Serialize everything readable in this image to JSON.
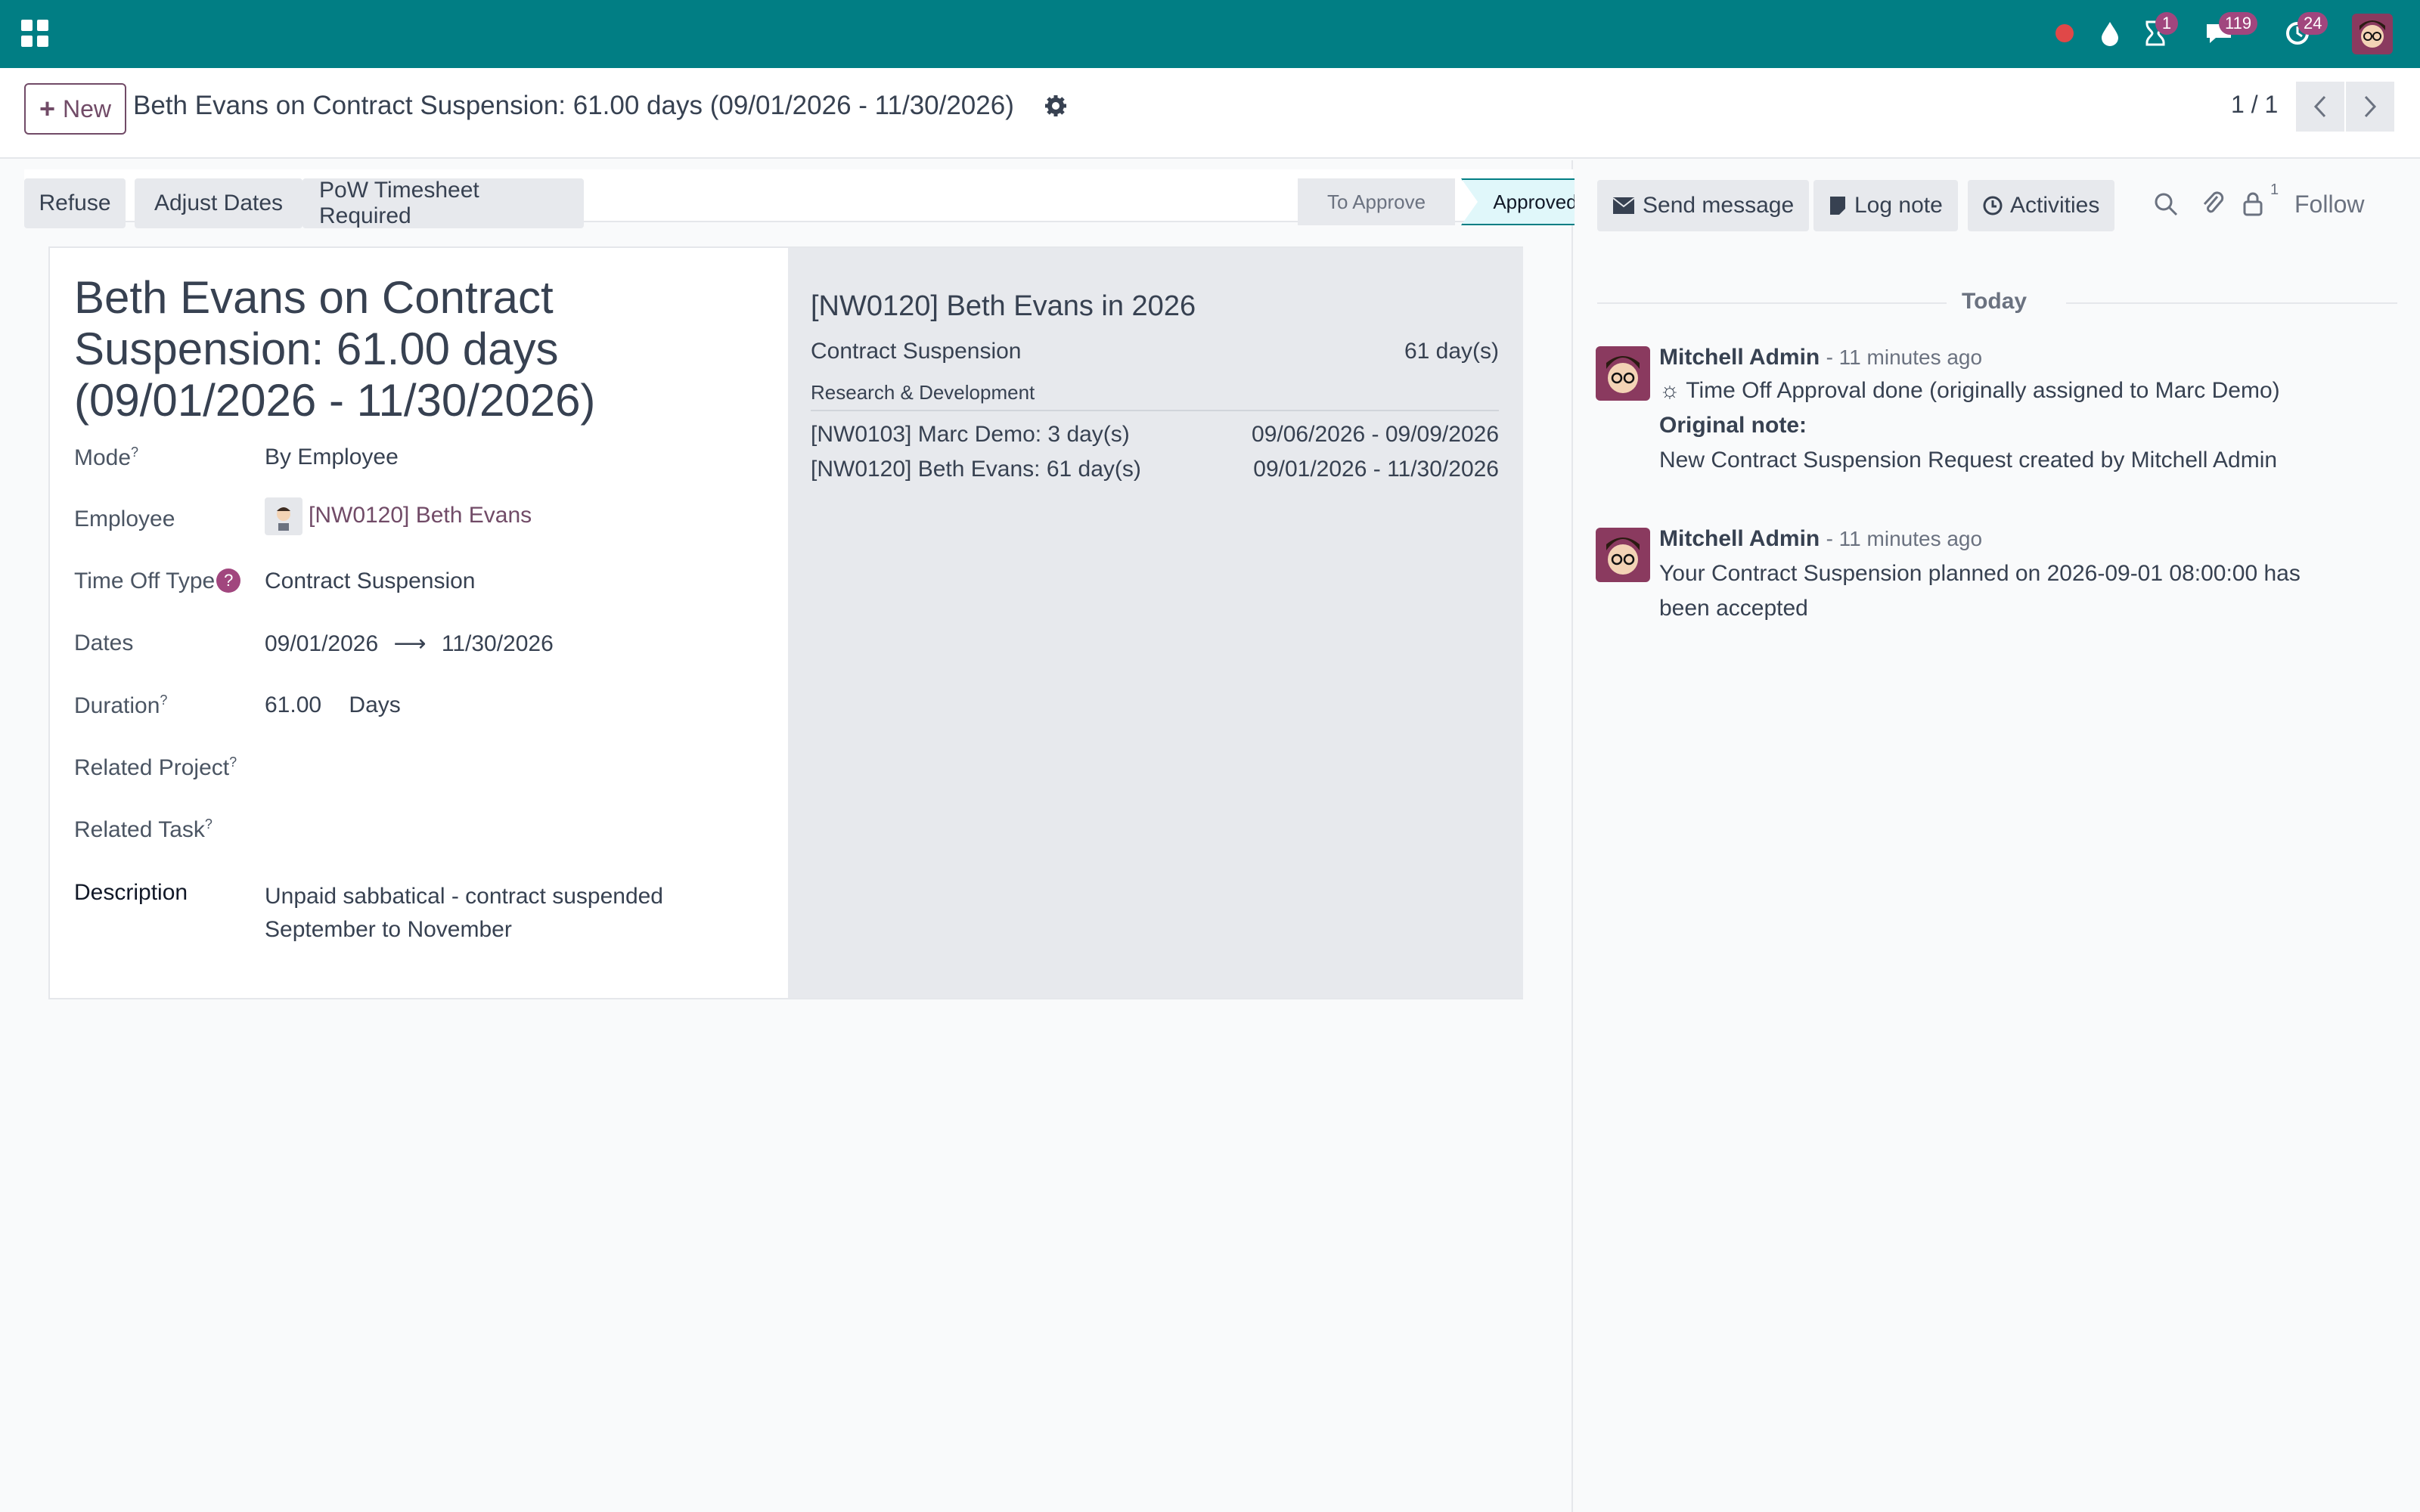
{
  "topbar": {
    "badges": {
      "activities": "1",
      "messages": "119",
      "updates": "24"
    }
  },
  "control": {
    "new_label": "New",
    "title": "Beth Evans on Contract Suspension: 61.00 days (09/01/2026 - 11/30/2026)",
    "pager": "1 / 1"
  },
  "statusbar": {
    "buttons": [
      "Refuse",
      "Adjust Dates",
      "PoW Timesheet Required"
    ],
    "stages": [
      "To Approve",
      "Approved"
    ]
  },
  "form": {
    "title": "Beth Evans on Contract Suspension: 61.00 days (09/01/2026 - 11/30/2026)",
    "fields": {
      "mode_label": "Mode",
      "mode_value": "By Employee",
      "employee_label": "Employee",
      "employee_value": "[NW0120] Beth Evans",
      "type_label": "Time Off Type",
      "type_value": "Contract Suspension",
      "dates_label": "Dates",
      "date_from": "09/01/2026",
      "date_to": "11/30/2026",
      "duration_label": "Duration",
      "duration_value": "61.00",
      "duration_unit": "Days",
      "project_label": "Related Project",
      "task_label": "Related Task",
      "desc_label": "Description",
      "desc_line1": "Unpaid sabbatical - contract suspended",
      "desc_line2": "September to November"
    },
    "side": {
      "title": "[NW0120] Beth Evans in 2026",
      "type": "Contract Suspension",
      "type_days": "61 day(s)",
      "department": "Research & Development",
      "rows": [
        {
          "name": "[NW0103] Marc Demo: 3 day(s)",
          "dates": "09/06/2026 - 09/09/2026"
        },
        {
          "name": "[NW0120] Beth Evans: 61 day(s)",
          "dates": "09/01/2026 - 11/30/2026"
        }
      ]
    }
  },
  "chatter": {
    "send_message": "Send message",
    "log_note": "Log note",
    "activities": "Activities",
    "follower_count": "1",
    "follow": "Follow",
    "today": "Today",
    "messages": [
      {
        "author": "Mitchell Admin",
        "time": "- 11 minutes ago",
        "line1": "Time Off Approval done (originally assigned to Marc Demo)",
        "line2": "Original note:",
        "line3": "New Contract Suspension Request created by Mitchell Admin"
      },
      {
        "author": "Mitchell Admin",
        "time": "- 11 minutes ago",
        "line1": "Your Contract Suspension planned on 2026-09-01 08:00:00 has",
        "line2": "been accepted"
      }
    ]
  }
}
